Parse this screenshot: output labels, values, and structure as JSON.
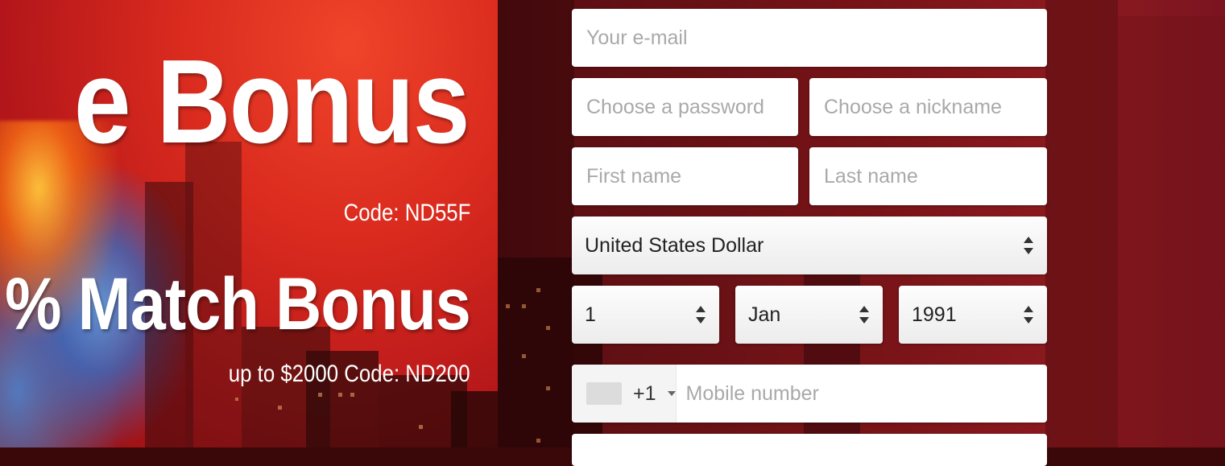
{
  "promo": {
    "headline_top": "e Bonus",
    "code_top": "Code: ND55F",
    "headline_bottom": "% Match Bonus",
    "code_bottom": "up to $2000 Code: ND200"
  },
  "form": {
    "email": {
      "placeholder": "Your e-mail",
      "value": ""
    },
    "password": {
      "placeholder": "Choose a password",
      "value": ""
    },
    "nickname": {
      "placeholder": "Choose a nickname",
      "value": ""
    },
    "first_name": {
      "placeholder": "First name",
      "value": ""
    },
    "last_name": {
      "placeholder": "Last name",
      "value": ""
    },
    "currency": {
      "selected": "United States Dollar"
    },
    "birth_day": {
      "selected": "1"
    },
    "birth_month": {
      "selected": "Jan"
    },
    "birth_year": {
      "selected": "1991"
    },
    "phone": {
      "country_code": "+1",
      "placeholder": "Mobile number",
      "value": ""
    }
  },
  "icons": {
    "select_arrows": "up-down-chevron-icon",
    "country_dropdown": "caret-down-icon",
    "flag": "country-flag-icon"
  },
  "colors": {
    "promo_red": "#d92a1e",
    "background_maroon": "#7a1418",
    "field_bg": "#ffffff",
    "placeholder_text": "#a9a9a9"
  }
}
